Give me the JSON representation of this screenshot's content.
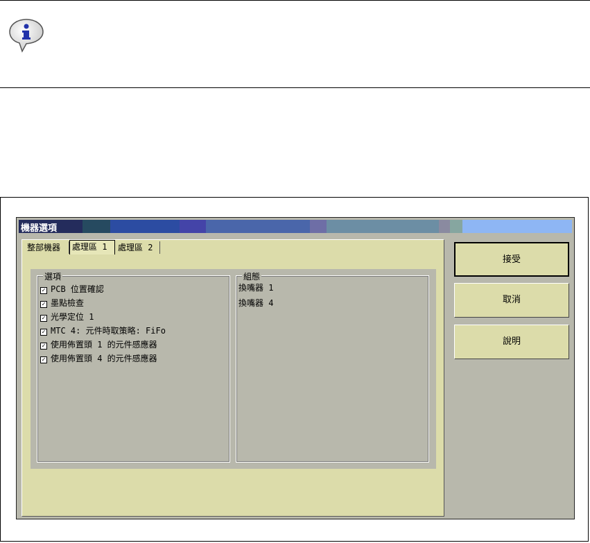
{
  "dialog": {
    "title": "機器選項",
    "tabs": [
      "整部機器",
      "處理區 1",
      "處理區 2"
    ],
    "active_tab": "處理區 1",
    "options": {
      "legend": "選項",
      "items": [
        {
          "label": "PCB 位置確認",
          "checked": true
        },
        {
          "label": "墨點檢查",
          "checked": true
        },
        {
          "label": "光學定位 1",
          "checked": true
        },
        {
          "label": "MTC 4: 元件時取策略: FiFo",
          "checked": true
        },
        {
          "label": "使用佈置頭 1 的元件感應器",
          "checked": true
        },
        {
          "label": "使用佈置頭 4 的元件感應器",
          "checked": true
        }
      ]
    },
    "config": {
      "legend": "組態",
      "items": [
        "換嘴器 1",
        "換嘴器 4"
      ]
    },
    "buttons": {
      "accept": "接受",
      "cancel": "取消",
      "help": "說明"
    }
  },
  "icons": {
    "info": "info-speech-bubble-icon",
    "checkbox": "checkmark-icon"
  },
  "colors": {
    "panel": "#dcdcaa",
    "dialog_bg": "#b8b8ac",
    "title_text": "#ffffff"
  }
}
